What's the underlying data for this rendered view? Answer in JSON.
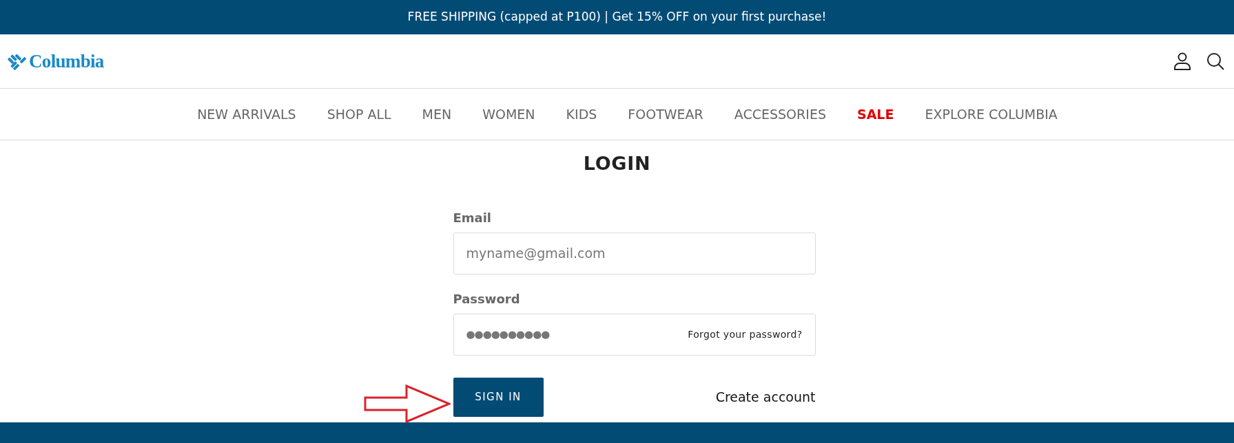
{
  "promo_bar": {
    "text": "FREE SHIPPING (capped at P100) | Get 15% OFF on your first purchase!"
  },
  "header": {
    "logo": "Columbia"
  },
  "nav": [
    {
      "label": "NEW ARRIVALS",
      "kind": "link"
    },
    {
      "label": "SHOP ALL",
      "kind": "link"
    },
    {
      "label": "MEN",
      "kind": "link"
    },
    {
      "label": "WOMEN",
      "kind": "link"
    },
    {
      "label": "KIDS",
      "kind": "link"
    },
    {
      "label": "FOOTWEAR",
      "kind": "link"
    },
    {
      "label": "ACCESSORIES",
      "kind": "link"
    },
    {
      "label": "SALE",
      "kind": "sale"
    },
    {
      "label": "EXPLORE COLUMBIA",
      "kind": "link"
    }
  ],
  "login": {
    "title": "LOGIN",
    "email": {
      "label": "Email",
      "placeholder": "myname@gmail.com"
    },
    "password": {
      "label": "Password",
      "value": "●●●●●●●●●●",
      "forgot_link": "Forgot your password?"
    },
    "sign_in_button": "SIGN IN",
    "create_account_link": "Create account"
  }
}
